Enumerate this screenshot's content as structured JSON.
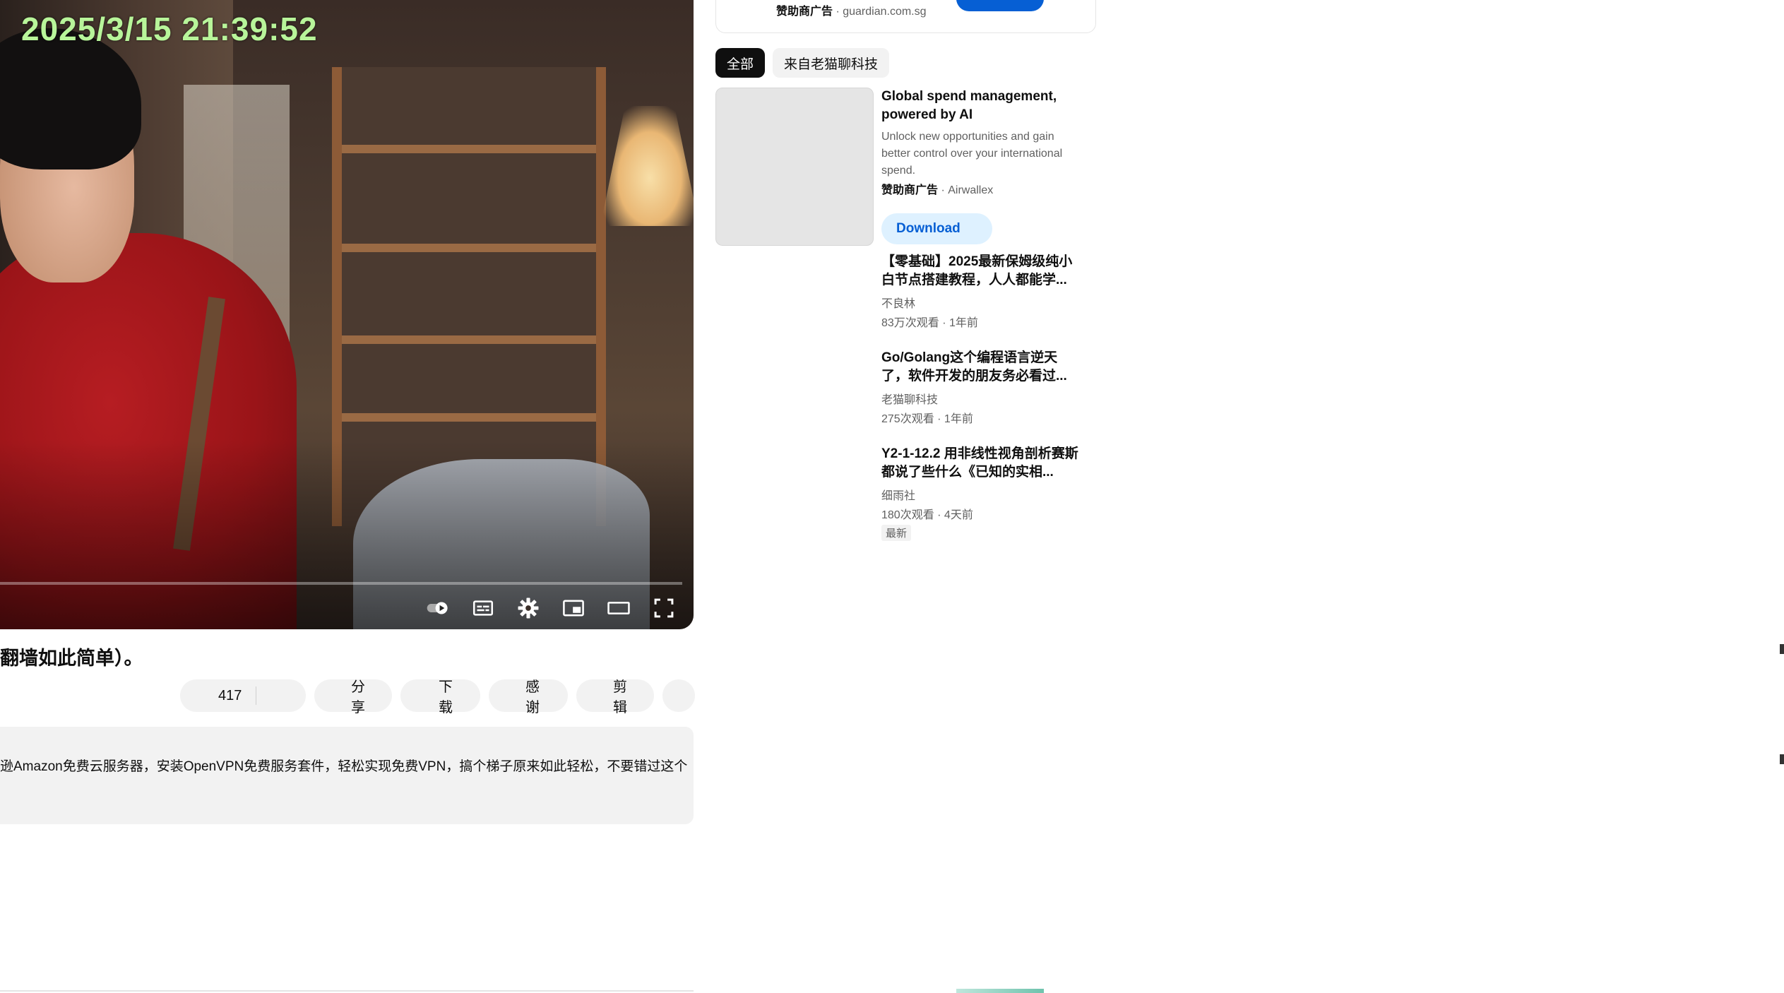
{
  "player": {
    "timestamp": "2025/3/15 21:39:52",
    "progress_fraction": 0.0,
    "controls": [
      "autoplay-toggle-icon",
      "captions-icon",
      "settings-icon",
      "miniplayer-icon",
      "theater-mode-icon",
      "fullscreen-icon"
    ]
  },
  "video": {
    "title": "翻墙如此简单）。",
    "description": "逊Amazon免费云服务器，安装OpenVPN免费服务套件，轻松实现免费VPN，搞个梯子原来如此轻松，不要错过这个"
  },
  "actions": {
    "like_count": "417",
    "share": "分享",
    "download": "下载",
    "thanks": "感谢",
    "clip": "剪辑"
  },
  "top_ad": {
    "sponsored_label": "赞助商广告",
    "separator": " · ",
    "domain": "guardian.com.sg"
  },
  "chips": [
    {
      "label": "全部",
      "active": true
    },
    {
      "label": "来自老猫聊科技",
      "active": false
    }
  ],
  "sponsor": {
    "title": "Global spend management, powered by AI",
    "description": "Unlock new opportunities and gain better control over your international spend.",
    "sponsored_label": "赞助商广告",
    "advertiser": "Airwallex",
    "button": "Download"
  },
  "recommendations": [
    {
      "title": "【零基础】2025最新保姆级纯小白节点搭建教程，人人都能学...",
      "channel": "不良林",
      "stats": "83万次观看 · 1年前",
      "badge": ""
    },
    {
      "title": "Go/Golang这个编程语言逆天了，软件开发的朋友务必看过...",
      "channel": "老猫聊科技",
      "stats": "275次观看 · 1年前",
      "badge": ""
    },
    {
      "title": "Y2-1-12.2 用非线性视角剖析赛斯都说了些什么《已知的实相...",
      "channel": "细雨社",
      "stats": "180次观看 · 4天前",
      "badge": "最新"
    }
  ],
  "colors": {
    "timestamp": "#b8f59a",
    "accent_blue": "#065fd4",
    "chip_active_bg": "#0f0f0f",
    "pill_bg": "#f2f2f2",
    "secondary_text": "#606060"
  }
}
